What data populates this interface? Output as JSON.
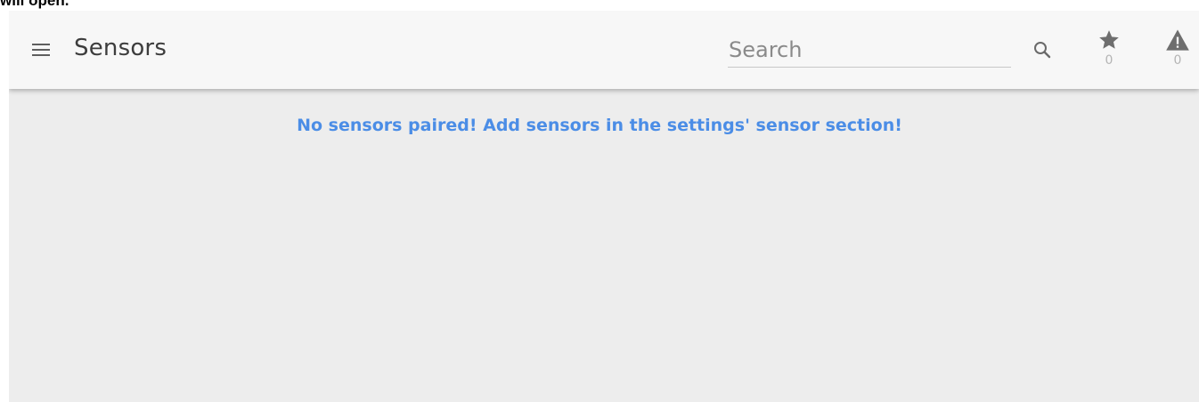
{
  "caption": "will open.",
  "header": {
    "title": "Sensors",
    "search": {
      "value": "",
      "placeholder": "Search"
    },
    "favorites": {
      "icon": "star-icon",
      "count": "0"
    },
    "alerts": {
      "icon": "warning-icon",
      "count": "0"
    }
  },
  "main": {
    "empty_message": "No sensors paired! Add sensors in the settings' sensor section!"
  },
  "colors": {
    "toolbar_bg": "#f7f7f7",
    "content_bg": "#ededed",
    "message": "#4b8de6",
    "icon": "#6a6a6a",
    "badge_count": "#b4b4b4"
  }
}
